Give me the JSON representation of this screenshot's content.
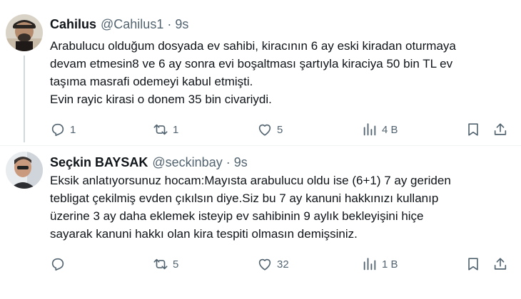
{
  "tweets": [
    {
      "author_name": "Cahilus",
      "handle": "@Cahilus1",
      "separator": "·",
      "time": "9s",
      "text_lines": [
        "Arabulucu olduğum dosyada ev sahibi, kiracının 6 ay eski kiradan oturmaya",
        "devam etmesin8 ve 6 ay sonra evi boşaltması şartıyla kiraciya 50 bin TL ev",
        "taşıma masrafi odemeyi kabul etmişti.",
        "Evin rayic kirasi o donem 35 bin civariydi."
      ],
      "replies": "1",
      "reposts": "1",
      "likes": "5",
      "views": "4 B"
    },
    {
      "author_name": "Seçkin BAYSAK",
      "handle": "@seckinbay",
      "separator": "·",
      "time": "9s",
      "text_lines": [
        "Eksik anlatıyorsunuz hocam:Mayısta arabulucu oldu ise (6+1) 7 ay geriden",
        "tebligat çekilmiş evden çıkılsın diye.Siz bu 7 ay kanuni hakkınızı kullanıp",
        "üzerine 3 ay daha eklemek isteyip ev sahibinin 9 aylık bekleyişini hiçe",
        "sayarak kanuni hakkı olan kira tespiti olmasın demişsiniz."
      ],
      "replies": "",
      "reposts": "5",
      "likes": "32",
      "views": "1 B"
    }
  ],
  "colors": {
    "text_primary": "#0f1419",
    "text_secondary": "#536471",
    "thread_line": "#cfd9de",
    "divider": "#eff3f4"
  }
}
